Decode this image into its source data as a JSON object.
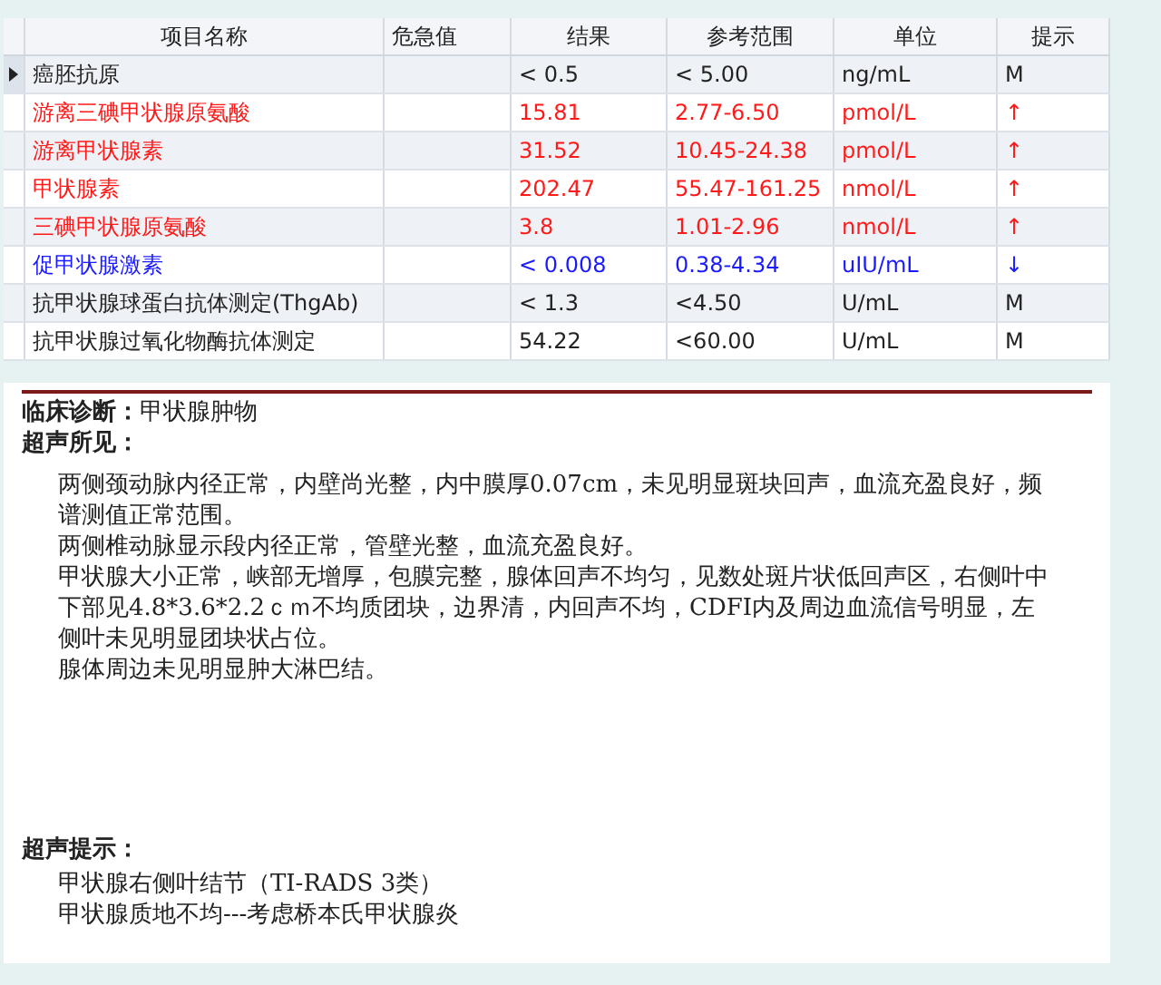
{
  "table": {
    "columns": [
      "项目名称",
      "危急值",
      "结果",
      "参考范围",
      "单位",
      "提示"
    ],
    "rows": [
      {
        "name": "癌胚抗原",
        "result": "< 0.5",
        "range": "< 5.00",
        "unit": "ng/mL",
        "flag": "M",
        "kind": "normal",
        "selected": true
      },
      {
        "name": "游离三碘甲状腺原氨酸",
        "result": "15.81",
        "range": "2.77-6.50",
        "unit": "pmol/L",
        "flag": "↑",
        "kind": "high",
        "selected": false
      },
      {
        "name": "游离甲状腺素",
        "result": "31.52",
        "range": "10.45-24.38",
        "unit": "pmol/L",
        "flag": "↑",
        "kind": "high",
        "selected": false
      },
      {
        "name": "甲状腺素",
        "result": "202.47",
        "range": "55.47-161.25",
        "unit": "nmol/L",
        "flag": "↑",
        "kind": "high",
        "selected": false
      },
      {
        "name": "三碘甲状腺原氨酸",
        "result": "3.8",
        "range": "1.01-2.96",
        "unit": "nmol/L",
        "flag": "↑",
        "kind": "high",
        "selected": false
      },
      {
        "name": "促甲状腺激素",
        "result": "< 0.008",
        "range": "0.38-4.34",
        "unit": "uIU/mL",
        "flag": "↓",
        "kind": "low",
        "selected": false
      },
      {
        "name": "抗甲状腺球蛋白抗体测定(ThgAb)",
        "result": "< 1.3",
        "range": "<4.50",
        "unit": "U/mL",
        "flag": "M",
        "kind": "normal",
        "selected": false
      },
      {
        "name": "抗甲状腺过氧化物酶抗体测定",
        "result": "54.22",
        "range": "<60.00",
        "unit": "U/mL",
        "flag": "M",
        "kind": "normal",
        "selected": false
      }
    ]
  },
  "report": {
    "diagnosis_label": "临床诊断：",
    "diagnosis": "甲状腺肿物",
    "findings_label": "超声所见：",
    "findings": [
      "两侧颈动脉内径正常，内壁尚光整，内中膜厚0.07cm，未见明显斑块回声，血流充盈良好，频谱测值正常范围。",
      "两侧椎动脉显示段内径正常，管壁光整，血流充盈良好。",
      "甲状腺大小正常，峡部无增厚，包膜完整，腺体回声不均匀，见数处斑片状低回声区，右侧叶中下部见4.8*3.6*2.2ｃｍ不均质团块，边界清，内回声不均，CDFI内及周边血流信号明显，左侧叶未见明显团块状占位。",
      "腺体周边未见明显肿大淋巴结。"
    ],
    "impression_label": "超声提示：",
    "impression": [
      "甲状腺右侧叶结节（TI-RADS 3类）",
      "甲状腺质地不均---考虑桥本氏甲状腺炎"
    ]
  }
}
